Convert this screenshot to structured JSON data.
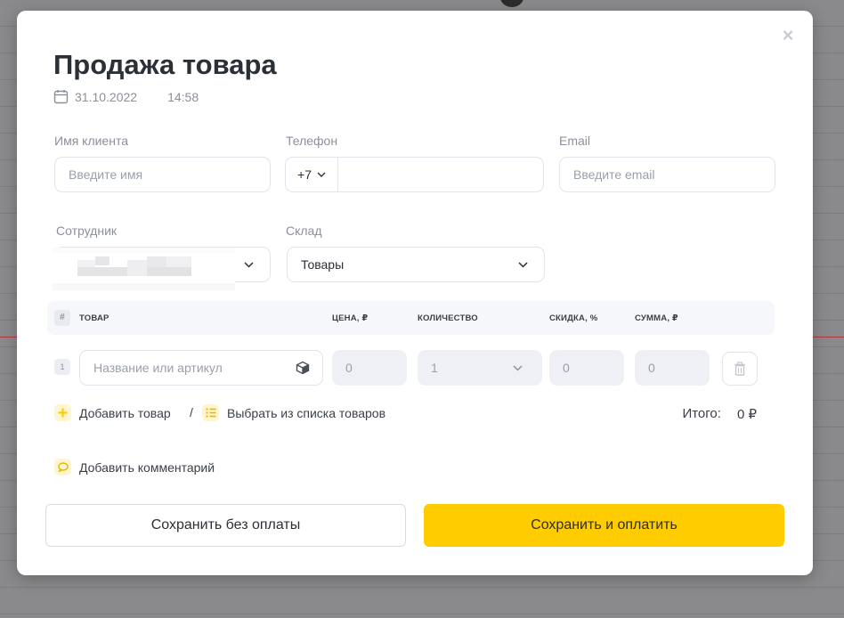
{
  "modal": {
    "title": "Продажа товара",
    "date": "31.10.2022",
    "time": "14:58",
    "close_label": "×"
  },
  "client": {
    "name_label": "Имя клиента",
    "name_placeholder": "Введите имя",
    "phone_label": "Телефон",
    "phone_code": "+7",
    "email_label": "Email",
    "email_placeholder": "Введите email"
  },
  "employee": {
    "label": "Сотрудник",
    "value": ""
  },
  "warehouse": {
    "label": "Склад",
    "value": "Товары"
  },
  "table": {
    "headers": {
      "num": "#",
      "product": "ТОВАР",
      "price": "ЦЕНА, ₽",
      "quantity": "КОЛИЧЕСТВО",
      "discount": "СКИДКА, %",
      "sum": "СУММА, ₽"
    },
    "rows": [
      {
        "num": "1",
        "product_placeholder": "Название или артикул",
        "price": "0",
        "quantity": "1",
        "discount": "0",
        "sum": "0"
      }
    ]
  },
  "actions": {
    "add_product": "Добавить товар",
    "separator": "/",
    "choose_from_list": "Выбрать из списка товаров",
    "add_comment": "Добавить комментарий"
  },
  "total": {
    "label": "Итого:",
    "value": "0 ₽"
  },
  "buttons": {
    "save_no_pay": "Сохранить без оплаты",
    "save_and_pay": "Сохранить и оплатить"
  },
  "colors": {
    "accent": "#ffcc00",
    "accent_soft": "#fff6cf",
    "border": "#e1e4ea",
    "muted_text": "#8b909a"
  }
}
